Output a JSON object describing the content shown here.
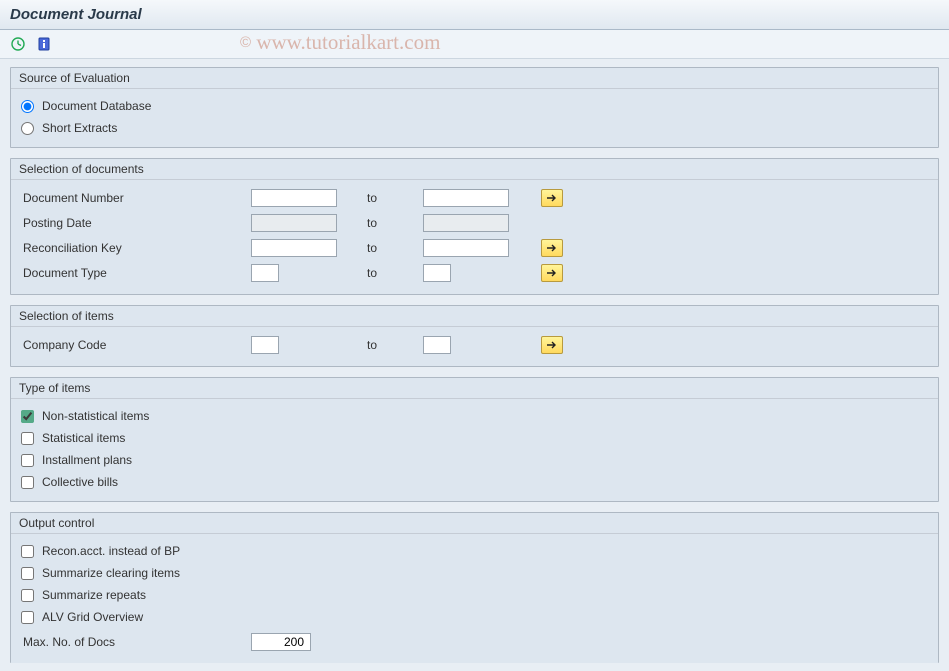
{
  "header": {
    "title": "Document Journal"
  },
  "watermark": "© www.tutorialkart.com",
  "groups": {
    "source": {
      "title": "Source of Evaluation",
      "opt1": "Document Database",
      "opt2": "Short Extracts"
    },
    "sel_docs": {
      "title": "Selection of documents",
      "doc_num": "Document Number",
      "posting_date": "Posting Date",
      "recon_key": "Reconciliation Key",
      "doc_type": "Document Type",
      "to": "to"
    },
    "sel_items": {
      "title": "Selection of items",
      "company_code": "Company Code",
      "to": "to"
    },
    "type_items": {
      "title": "Type of items",
      "nonstat": "Non-statistical items",
      "stat": "Statistical items",
      "install": "Installment plans",
      "collective": "Collective bills"
    },
    "output": {
      "title": "Output control",
      "recon": "Recon.acct. instead of BP",
      "summ_clear": "Summarize clearing items",
      "summ_rep": "Summarize repeats",
      "alv": "ALV Grid Overview",
      "max_docs_label": "Max. No. of Docs",
      "max_docs_value": "200"
    }
  }
}
